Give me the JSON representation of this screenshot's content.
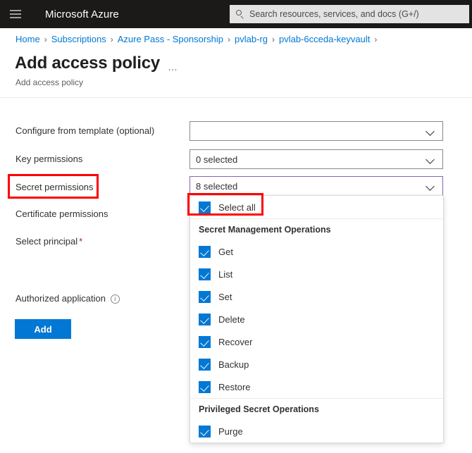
{
  "topbar": {
    "menu_icon": "hamburger-icon",
    "brand": "Microsoft Azure",
    "search_icon": "search-icon",
    "search_placeholder": "Search resources, services, and docs (G+/)"
  },
  "breadcrumb": {
    "separator": "›",
    "items": [
      "Home",
      "Subscriptions",
      "Azure Pass - Sponsorship",
      "pvlab-rg",
      "pvlab-6cceda-keyvault"
    ]
  },
  "page": {
    "title": "Add access policy",
    "more_actions": "…",
    "subtitle": "Add access policy"
  },
  "form": {
    "fields": [
      {
        "label": "Configure from template (optional)",
        "value": "",
        "focused": false
      },
      {
        "label": "Key permissions",
        "value": "0 selected",
        "focused": false
      },
      {
        "label": "Secret permissions",
        "value": "8 selected",
        "focused": true
      }
    ],
    "certificate_permissions_label": "Certificate permissions",
    "select_principal_label": "Select principal",
    "select_principal_required": "*",
    "authorized_application_label": "Authorized application",
    "authorized_application_info_icon": "info-icon",
    "add_button": "Add"
  },
  "dropdown": {
    "select_all_label": "Select all",
    "groups": [
      {
        "header": "Secret Management Operations",
        "items": [
          {
            "label": "Get",
            "checked": true
          },
          {
            "label": "List",
            "checked": true
          },
          {
            "label": "Set",
            "checked": true
          },
          {
            "label": "Delete",
            "checked": true
          },
          {
            "label": "Recover",
            "checked": true
          },
          {
            "label": "Backup",
            "checked": true
          },
          {
            "label": "Restore",
            "checked": true
          }
        ]
      },
      {
        "header": "Privileged Secret Operations",
        "items": [
          {
            "label": "Purge",
            "checked": true
          }
        ]
      }
    ]
  },
  "colors": {
    "topbar_bg": "#1b1a19",
    "accent_blue": "#0078d4",
    "link_blue": "#0078d4",
    "focus_purple": "#8764b8",
    "annotation_red": "#ff0000",
    "required_red": "#a4262c"
  },
  "annotations": [
    {
      "name": "secret-permissions-highlight",
      "target": "Secret permissions"
    },
    {
      "name": "select-all-highlight",
      "target": "Select all"
    }
  ]
}
